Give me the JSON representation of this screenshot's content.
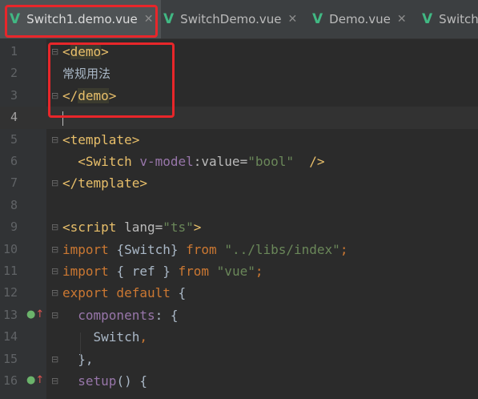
{
  "tabs": [
    {
      "label": "Switch1.demo.vue",
      "active": true
    },
    {
      "label": "SwitchDemo.vue",
      "active": false
    },
    {
      "label": "Demo.vue",
      "active": false
    },
    {
      "label": "Switch",
      "active": false
    }
  ],
  "icons": {
    "vue": "vue-file-icon",
    "close": "close-icon"
  },
  "colors": {
    "highlight": "#e8262a",
    "vue": "#41b883"
  },
  "editor": {
    "lines": [
      {
        "n": "1",
        "tokens": [
          {
            "c": "t-tag",
            "t": "<"
          },
          {
            "c": "t-tag t-tagbg",
            "t": "demo"
          },
          {
            "c": "t-tag",
            "t": ">"
          }
        ]
      },
      {
        "n": "2",
        "tokens": [
          {
            "c": "t-txt",
            "t": "常规用法"
          }
        ]
      },
      {
        "n": "3",
        "tokens": [
          {
            "c": "t-tag",
            "t": "</"
          },
          {
            "c": "t-tag t-tagbg",
            "t": "demo"
          },
          {
            "c": "t-tag",
            "t": ">"
          }
        ]
      },
      {
        "n": "4",
        "tokens": []
      },
      {
        "n": "5",
        "tokens": [
          {
            "c": "t-tag",
            "t": "<template>"
          }
        ]
      },
      {
        "n": "6",
        "tokens": [
          {
            "c": "",
            "t": "  "
          },
          {
            "c": "t-tag",
            "t": "<Switch "
          },
          {
            "c": "t-dir",
            "t": "v-model"
          },
          {
            "c": "t-attr",
            "t": ":value="
          },
          {
            "c": "t-str",
            "t": "\"bool\""
          },
          {
            "c": "t-tag",
            "t": "  />"
          }
        ]
      },
      {
        "n": "7",
        "tokens": [
          {
            "c": "t-tag",
            "t": "</template>"
          }
        ]
      },
      {
        "n": "8",
        "tokens": []
      },
      {
        "n": "9",
        "tokens": [
          {
            "c": "t-tag",
            "t": "<script "
          },
          {
            "c": "t-attr",
            "t": "lang="
          },
          {
            "c": "t-str",
            "t": "\"ts\""
          },
          {
            "c": "t-tag",
            "t": ">"
          }
        ]
      },
      {
        "n": "10",
        "tokens": [
          {
            "c": "t-kw",
            "t": "import "
          },
          {
            "c": "",
            "t": "{Switch} "
          },
          {
            "c": "t-kw",
            "t": "from "
          },
          {
            "c": "t-str",
            "t": "\"../libs/index\""
          },
          {
            "c": "t-punc",
            "t": ";"
          }
        ]
      },
      {
        "n": "11",
        "tokens": [
          {
            "c": "t-kw",
            "t": "import "
          },
          {
            "c": "",
            "t": "{ ref } "
          },
          {
            "c": "t-kw",
            "t": "from "
          },
          {
            "c": "t-str",
            "t": "\"vue\""
          },
          {
            "c": "t-punc",
            "t": ";"
          }
        ]
      },
      {
        "n": "12",
        "tokens": [
          {
            "c": "t-kw",
            "t": "export default "
          },
          {
            "c": "",
            "t": "{"
          }
        ]
      },
      {
        "n": "13",
        "tokens": [
          {
            "c": "",
            "t": "  "
          },
          {
            "c": "t-dir",
            "t": "components"
          },
          {
            "c": "",
            "t": ": {"
          }
        ]
      },
      {
        "n": "14",
        "tokens": [
          {
            "c": "",
            "t": "    Switch"
          },
          {
            "c": "t-punc",
            "t": ","
          }
        ]
      },
      {
        "n": "15",
        "tokens": [
          {
            "c": "",
            "t": "  },"
          }
        ]
      },
      {
        "n": "16",
        "tokens": [
          {
            "c": "",
            "t": "  "
          },
          {
            "c": "t-dir",
            "t": "setup"
          },
          {
            "c": "",
            "t": "() {"
          }
        ]
      }
    ]
  }
}
